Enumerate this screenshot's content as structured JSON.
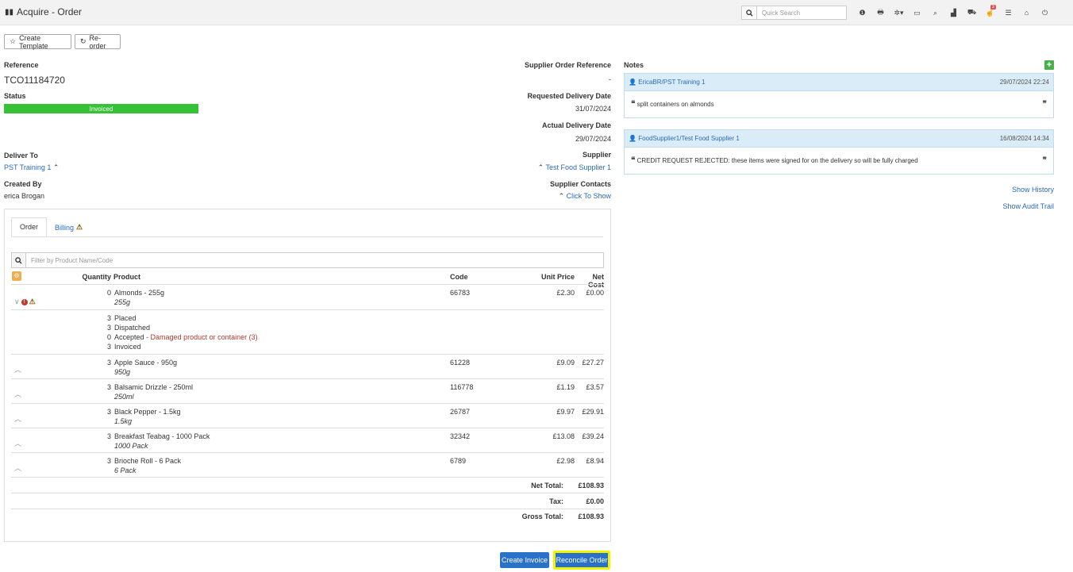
{
  "app": {
    "title": "Acquire - Order"
  },
  "search": {
    "placeholder": "Quick Search"
  },
  "nav": {
    "icons": [
      {
        "name": "info-circle-icon",
        "glyph": "❶"
      },
      {
        "name": "print-icon",
        "glyph": "🖶"
      },
      {
        "name": "settings-icon",
        "glyph": "✲▾"
      },
      {
        "name": "card-icon",
        "glyph": "▭"
      },
      {
        "name": "search-nav-icon",
        "glyph": "⌕"
      },
      {
        "name": "bar-chart-icon",
        "glyph": "▟"
      },
      {
        "name": "cart-icon",
        "glyph": "⛟"
      },
      {
        "name": "notifications-icon",
        "glyph": "☝"
      },
      {
        "name": "list-icon",
        "glyph": "☰"
      },
      {
        "name": "home-icon",
        "glyph": "⌂"
      },
      {
        "name": "power-icon",
        "glyph": "⏻"
      }
    ],
    "notification_count": "3"
  },
  "toolbar": {
    "create_template": "Create Template",
    "reorder": "Re-order"
  },
  "order": {
    "reference_label": "Reference",
    "reference": "TCO11184720",
    "status_label": "Status",
    "status": "Invoiced",
    "deliver_to_label": "Deliver To",
    "deliver_to": "PST Training 1",
    "created_by_label": "Created By",
    "created_by": "erica Brogan",
    "supplier_ref_label": "Supplier Order Reference",
    "supplier_ref": "-",
    "requested_delivery_label": "Requested Delivery Date",
    "requested_delivery": "31/07/2024",
    "actual_delivery_label": "Actual Delivery Date",
    "actual_delivery": "29/07/2024",
    "supplier_label": "Supplier",
    "supplier": "Test Food Supplier 1",
    "supplier_contacts_label": "Supplier Contacts",
    "supplier_contacts_action": "Click To Show"
  },
  "tabs": {
    "order": "Order",
    "billing": "Billing"
  },
  "filter": {
    "placeholder": "Filter by Product Name/Code"
  },
  "table": {
    "headers": {
      "quantity": "Quantity",
      "product": "Product",
      "code": "Code",
      "unit_price": "Unit Price",
      "net_cost": "Net Cost"
    },
    "rows": [
      {
        "qty": "0",
        "name": "Almonds - 255g",
        "size": "255g",
        "code": "66783",
        "unit": "£2.30",
        "net": "£0.00"
      },
      {
        "qty": "3",
        "name": "Apple Sauce - 950g",
        "size": "950g",
        "code": "61228",
        "unit": "£9.09",
        "net": "£27.27"
      },
      {
        "qty": "3",
        "name": "Balsamic Drizzle - 250ml",
        "size": "250ml",
        "code": "116778",
        "unit": "£1.19",
        "net": "£3.57"
      },
      {
        "qty": "3",
        "name": "Black Pepper - 1.5kg",
        "size": "1.5kg",
        "code": "26787",
        "unit": "£9.97",
        "net": "£29.91"
      },
      {
        "qty": "3",
        "name": "Breakfast Teabag - 1000 Pack",
        "size": "1000 Pack",
        "code": "32342",
        "unit": "£13.08",
        "net": "£39.24"
      },
      {
        "qty": "3",
        "name": "Brioche Roll - 6 Pack",
        "size": "6 Pack",
        "code": "6789",
        "unit": "£2.98",
        "net": "£8.94"
      }
    ],
    "detail": {
      "placed_qty": "3",
      "placed": "Placed",
      "dispatched_qty": "3",
      "dispatched": "Dispatched",
      "accepted_qty": "0",
      "accepted": "Accepted",
      "accepted_reason": "- Damaged product or container (3)",
      "invoiced_qty": "3",
      "invoiced": "Invoiced"
    },
    "totals": {
      "net_label": "Net Total:",
      "net": "£108.93",
      "tax_label": "Tax:",
      "tax": "£0.00",
      "gross_label": "Gross Total:",
      "gross": "£108.93"
    }
  },
  "actions": {
    "create_invoice": "Create Invoice",
    "reconcile_order": "Reconcile Order"
  },
  "notes": {
    "title": "Notes",
    "items": [
      {
        "author": "EricaBR/PST Training 1",
        "date": "29/07/2024 22:24",
        "text": "split containers on almonds"
      },
      {
        "author": "FoodSupplier1/Test Food Supplier 1",
        "date": "16/08/2024 14:34",
        "text": "CREDIT REQUEST REJECTED: these items were signed for on the delivery so will be fully charged"
      }
    ],
    "show_history": "Show History",
    "show_audit_trail": "Show Audit Trail"
  }
}
